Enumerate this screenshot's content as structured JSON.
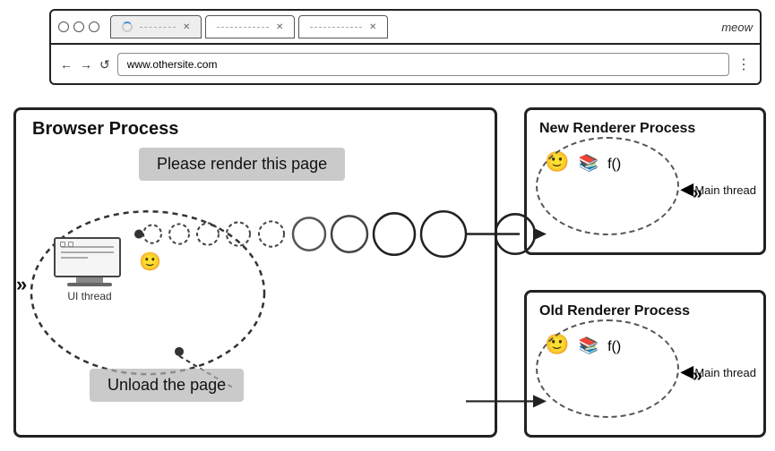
{
  "browser_chrome": {
    "tabs": [
      {
        "label": "",
        "loading": true,
        "active": true
      },
      {
        "label": "",
        "loading": false,
        "active": false
      },
      {
        "label": "",
        "loading": false,
        "active": false
      }
    ],
    "meow_label": "meow",
    "address": "www.othersite.com",
    "nav_back": "←",
    "nav_forward": "→",
    "nav_refresh": "↺",
    "menu_dots": "⋮"
  },
  "diagram": {
    "browser_process_label": "Browser Process",
    "new_renderer_label": "New Renderer Process",
    "old_renderer_label": "Old Renderer Process",
    "render_message": "Please render this page",
    "unload_message": "Unload the page",
    "ui_thread_label": "UI thread",
    "main_thread_label_new": "Main thread",
    "main_thread_label_old": "Main thread"
  }
}
